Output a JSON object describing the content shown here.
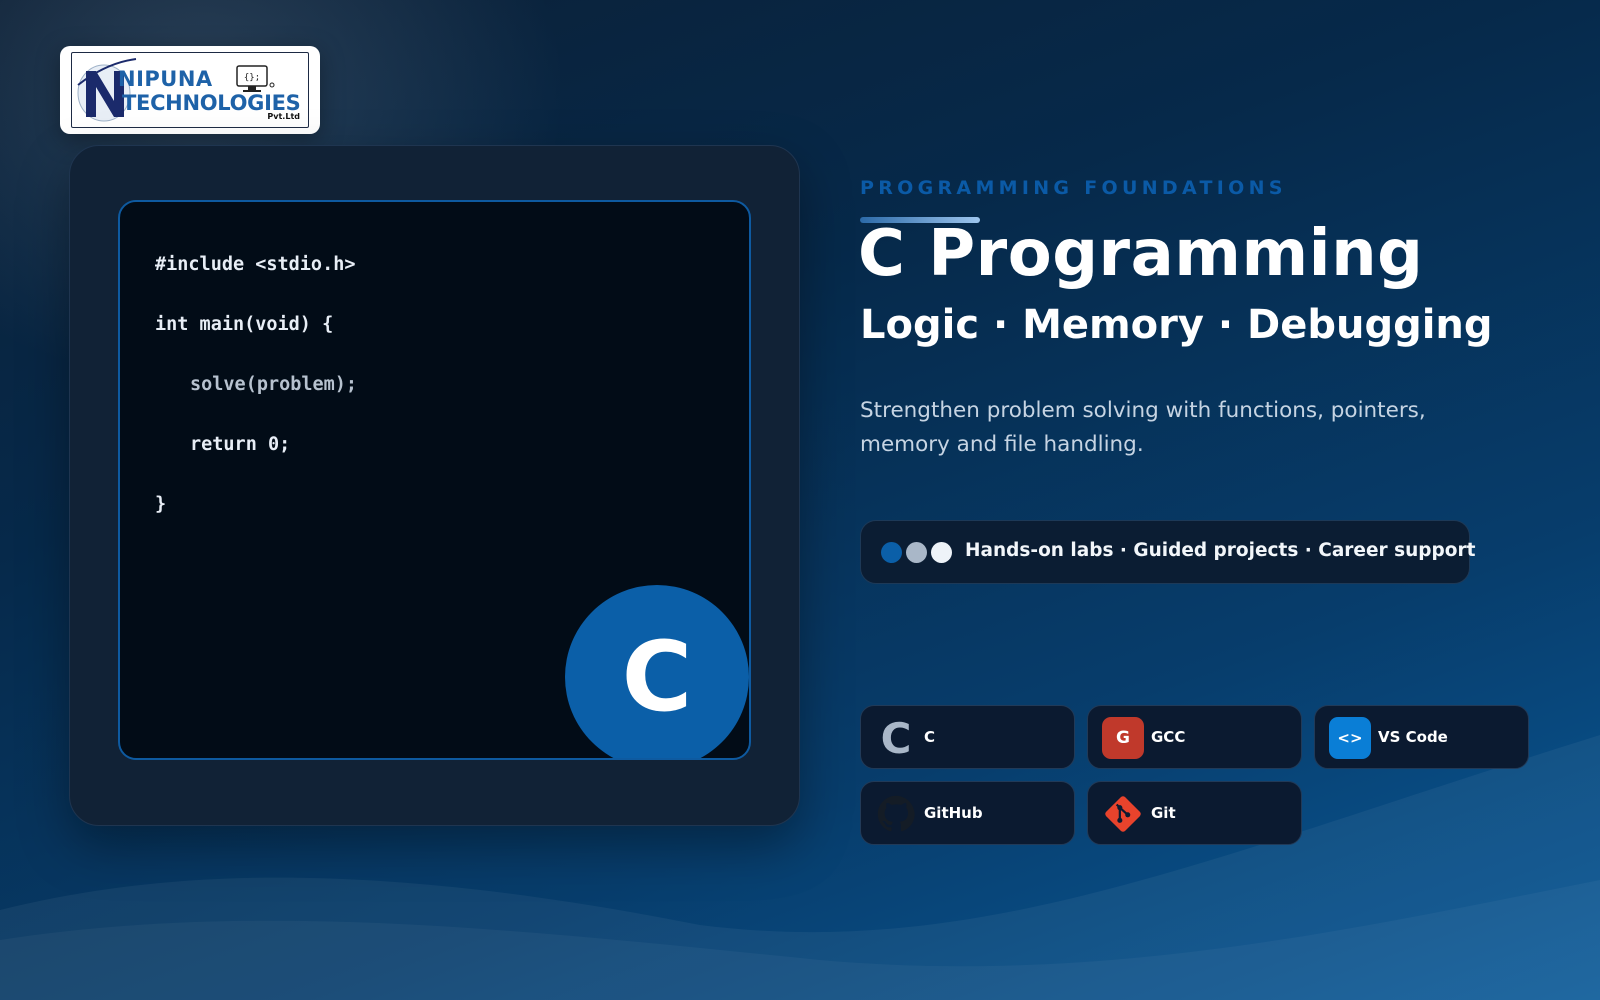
{
  "brand": {
    "logo_line1": "NIPUNA",
    "logo_line2": "TECHNOLOGIES",
    "logo_line3": "Pvt.Ltd",
    "logo_screen_text": "{};"
  },
  "code": {
    "lines": [
      "#include <stdio.h>",
      "int main(void) {",
      "solve(problem);",
      "return 0;",
      "}"
    ],
    "badge_letter": "C"
  },
  "hero": {
    "eyebrow": "PROGRAMMING FOUNDATIONS",
    "title": "C Programming",
    "subtitle": "Logic · Memory · Debugging",
    "description": "Strengthen problem solving with functions, pointers, memory and file handling."
  },
  "features": {
    "text": "Hands-on labs · Guided projects · Career support"
  },
  "tools": [
    {
      "label": "C",
      "icon": "c-language-icon",
      "glyph": "C",
      "color": "#a9b7c8"
    },
    {
      "label": "GCC",
      "icon": "gcc-icon",
      "glyph": "G",
      "color": "#c0392b"
    },
    {
      "label": "VS Code",
      "icon": "vscode-icon",
      "glyph": "<>",
      "color": "#0a7ed6"
    },
    {
      "label": "GitHub",
      "icon": "github-icon",
      "glyph": "",
      "color": "#111a24"
    },
    {
      "label": "Git",
      "icon": "git-icon",
      "glyph": "",
      "color": "#e8432c"
    }
  ],
  "colors": {
    "accent_blue": "#0b5fa8",
    "eyebrow_blue": "#0b5aa6",
    "chip_bg": "#0b1a30",
    "code_bg": "#020c17"
  }
}
